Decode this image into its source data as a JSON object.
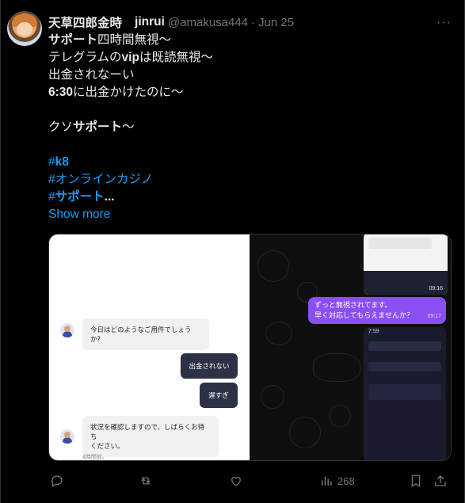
{
  "post": {
    "display_name": "天草四郎金時",
    "handle_name": "jinrui",
    "handle": "@amakusa444",
    "separator": "·",
    "date": "Jun 25",
    "more_label": "···",
    "lines": [
      {
        "pre": "",
        "bold": "サポート",
        "post": "四時間無視〜"
      },
      {
        "pre": "テレグラムの",
        "bold": "vip",
        "post": "は既読無視〜"
      },
      {
        "pre": "出金されなーい",
        "bold": "",
        "post": ""
      },
      {
        "pre": "",
        "bold": "6:30",
        "post": "に出金かけたのに〜"
      },
      {
        "pre": "",
        "bold": "",
        "post": ""
      },
      {
        "pre": "クソ",
        "bold": "サポート",
        "post": "〜"
      },
      {
        "pre": "",
        "bold": "",
        "post": ""
      }
    ],
    "hashtags": {
      "tag1_hash": "#",
      "tag1_bold": "k8",
      "tag2": "#オンラインカジノ",
      "tag3_hash": "#",
      "tag3_bold": "サポート",
      "tag3_ellipsis": "..."
    },
    "show_more": "Show more"
  },
  "media": {
    "chat_left": {
      "bot_msg_1": "今日はどのようなご用件でしょうか？",
      "user_msg_1": "出金されない",
      "user_msg_2": "遅すぎ",
      "bot_msg_2": "状況を確認しますので、しばらくお待ち\nください。",
      "timestamp": "4時間前。"
    },
    "chat_right": {
      "purple_msg": "ずっと無視されてます。\n早く対応してもらえませんか？",
      "purple_time": "09:17",
      "top_time": "09:16",
      "phone_time": "7:59"
    }
  },
  "actions": {
    "reply_icon": "reply-icon",
    "repost_icon": "repost-icon",
    "like_icon": "heart-icon",
    "views_icon": "views-icon",
    "views_count": "268",
    "bookmark_icon": "bookmark-icon",
    "share_icon": "share-icon"
  },
  "colors": {
    "background": "#000000",
    "text": "#e7e9ea",
    "muted": "#71767b",
    "link": "#1d9bf0",
    "purple_bubble": "#8a4ff0"
  }
}
